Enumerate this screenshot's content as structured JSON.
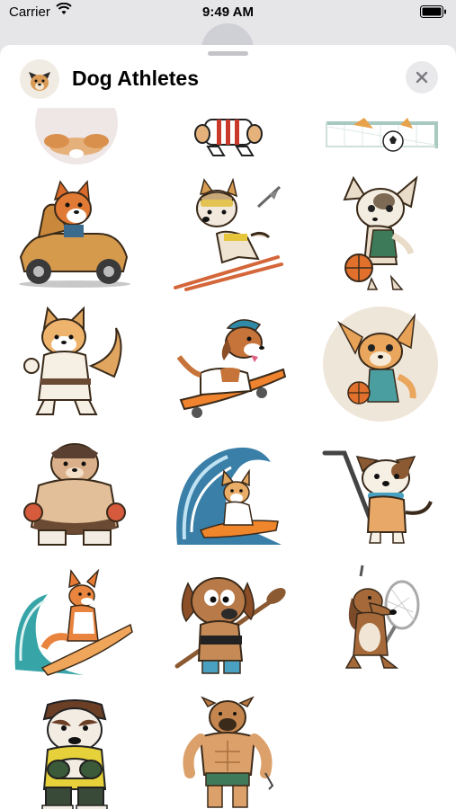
{
  "status_bar": {
    "carrier": "Carrier",
    "time": "9:49 AM"
  },
  "sheet": {
    "title": "Dog Athletes",
    "close_icon": "close-icon",
    "app_icon": "dog-athletes-app-icon"
  },
  "stickers": [
    {
      "name": "corgi-circle"
    },
    {
      "name": "dog-striped-shirt"
    },
    {
      "name": "dog-soccer-goal"
    },
    {
      "name": "shiba-race-car"
    },
    {
      "name": "husky-skiing"
    },
    {
      "name": "chihuahua-basketball"
    },
    {
      "name": "corgi-karate"
    },
    {
      "name": "beagle-skateboard"
    },
    {
      "name": "chihuahua-basketball-circle"
    },
    {
      "name": "bulldog-sumo"
    },
    {
      "name": "corgi-surfing-wave"
    },
    {
      "name": "dog-hockey"
    },
    {
      "name": "fox-dog-surfing"
    },
    {
      "name": "hound-paddle"
    },
    {
      "name": "hound-tennis-racket"
    },
    {
      "name": "bulldog-boxer"
    },
    {
      "name": "boxer-muscle"
    }
  ],
  "colors": {
    "sheet_background": "#ffffff",
    "backdrop": "#e6e6e9",
    "close_button": "#e9e9ec"
  }
}
